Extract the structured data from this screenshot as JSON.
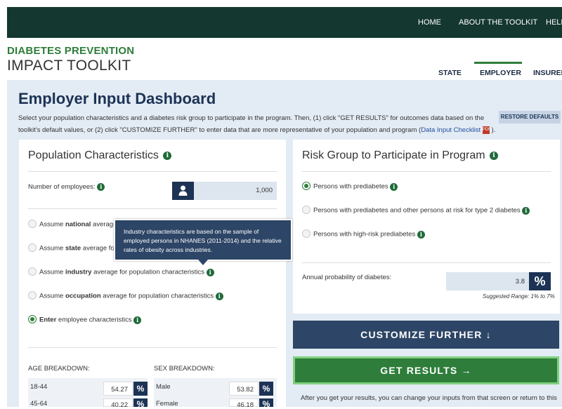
{
  "nav": {
    "home": "HOME",
    "about": "ABOUT THE TOOLKIT",
    "help": "HELP"
  },
  "brand": {
    "line1": "DIABETES PREVENTION",
    "line2": "IMPACT TOOLKIT"
  },
  "tabs": {
    "state": "STATE",
    "employer": "EMPLOYER",
    "insurer": "INSURER"
  },
  "dashboard": {
    "title": "Employer Input Dashboard",
    "intro_part1": "Select your population characteristics and a diabetes risk group to participate in the program. Then, (1) click \"GET RESULTS\" for outcomes data based on the toolkit's default values, or (2) click \"CUSTOMIZE FURTHER\" to enter data that are more representative of your population and program (",
    "intro_link": "Data Input Checklist",
    "intro_part2": " ).",
    "restore_label": "RESTORE DEFAULTS"
  },
  "population": {
    "title": "Population Characteristics",
    "employees_label": "Number of employees:",
    "employees_value": "1,000",
    "options": [
      {
        "pre": "Assume ",
        "bold": "national",
        "post": " average for population characteristics",
        "selected": false
      },
      {
        "pre": "Assume ",
        "bold": "state",
        "post": " average for population characteristics",
        "selected": false
      },
      {
        "pre": "Assume ",
        "bold": "industry",
        "post": " average for population characteristics",
        "selected": false
      },
      {
        "pre": "Assume ",
        "bold": "occupation",
        "post": " average for population characteristics",
        "selected": false
      },
      {
        "pre": "",
        "bold": "Enter",
        "post": " employee characteristics",
        "selected": true
      }
    ],
    "tooltip": "Industry characteristics are based on the sample of employed persons in NHANES (2011-2014) and the relative rates of obesity across industries.",
    "age": {
      "header": "AGE BREAKDOWN:",
      "rows": [
        {
          "label": "18-44",
          "value": "54.27"
        },
        {
          "label": "45-64",
          "value": "40.22"
        }
      ]
    },
    "sex": {
      "header": "SEX BREAKDOWN:",
      "rows": [
        {
          "label": "Male",
          "value": "53.82"
        },
        {
          "label": "Female",
          "value": "46.18"
        }
      ]
    },
    "pct_symbol": "%"
  },
  "risk": {
    "title": "Risk Group to Participate in Program",
    "options": [
      {
        "label": "Persons with prediabetes",
        "selected": true
      },
      {
        "label": "Persons with prediabetes and other persons at risk for type 2 diabetes",
        "selected": false
      },
      {
        "label": "Persons with high-risk prediabetes",
        "selected": false
      }
    ],
    "prob_label": "Annual probability of diabetes:",
    "prob_value": "3.8",
    "suggested": "Suggested Range: 1% to 7%"
  },
  "buttons": {
    "customize": "CUSTOMIZE FURTHER",
    "results": "GET RESULTS"
  },
  "after_text": "After you get your results, you can change your inputs from that screen or return to this",
  "colors": {
    "nav_bg": "#14372f",
    "brand_green": "#2e7d3a",
    "navy": "#1c3355",
    "panel_bg": "#e3ebf4"
  },
  "icons": {
    "info": "info-icon",
    "person": "person-icon",
    "pdf": "pdf-icon",
    "arrow_down": "arrow-down-icon",
    "arrow_right": "arrow-right-icon"
  }
}
